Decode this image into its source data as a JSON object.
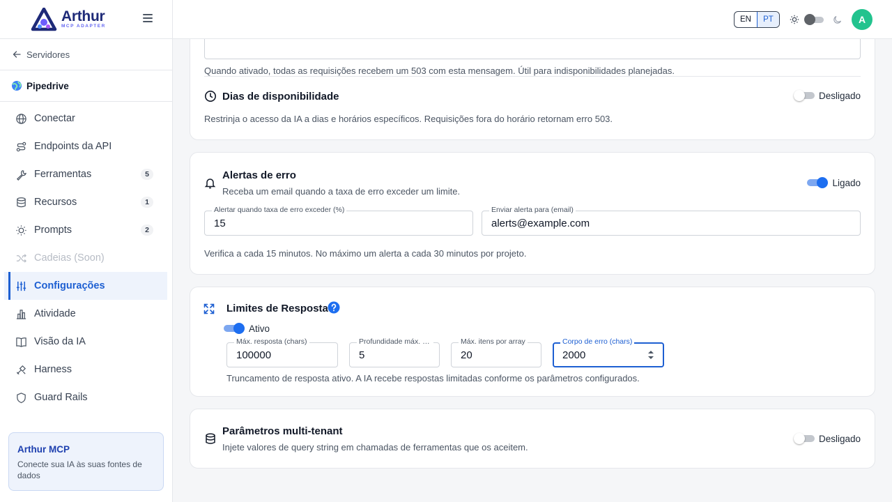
{
  "app": {
    "name": "Arthur",
    "subtitle": "MCP ADAPTER"
  },
  "sidebar": {
    "back_label": "Servidores",
    "server_name": "Pipedrive",
    "items": [
      {
        "label": "Conectar",
        "icon": "globe-icon"
      },
      {
        "label": "Endpoints da API",
        "icon": "route-icon"
      },
      {
        "label": "Ferramentas",
        "icon": "wrench-icon",
        "badge": "5"
      },
      {
        "label": "Recursos",
        "icon": "database-icon",
        "badge": "1"
      },
      {
        "label": "Prompts",
        "icon": "bulb-icon",
        "badge": "2"
      },
      {
        "label": "Cadeias (Soon)",
        "icon": "shuffle-icon"
      },
      {
        "label": "Configurações",
        "icon": "sliders-icon"
      },
      {
        "label": "Atividade",
        "icon": "chart-icon"
      },
      {
        "label": "Visão da IA",
        "icon": "book-icon"
      },
      {
        "label": "Harness",
        "icon": "tools-icon"
      },
      {
        "label": "Guard Rails",
        "icon": "shield-icon"
      }
    ],
    "promo": {
      "title": "Arthur MCP",
      "text": "Conecte sua IA às suas fontes de dados"
    }
  },
  "topbar": {
    "lang_en": "EN",
    "lang_pt": "PT",
    "avatar_initial": "A"
  },
  "maintenance": {
    "help": "Quando ativado, todas as requisições recebem um 503 com esta mensagem. Útil para indisponibilidades planejadas."
  },
  "availability": {
    "title": "Dias de disponibilidade",
    "status": "Desligado",
    "help": "Restrinja o acesso da IA a dias e horários específicos. Requisições fora do horário retornam erro 503."
  },
  "error_alerts": {
    "title": "Alertas de erro",
    "subtitle": "Receba um email quando a taxa de erro exceder um limite.",
    "status": "Ligado",
    "threshold_label": "Alertar quando taxa de erro exceder (%)",
    "threshold_value": "15",
    "email_label": "Enviar alerta para (email)",
    "email_value": "alerts@example.com",
    "help": "Verifica a cada 15 minutos. No máximo um alerta a cada 30 minutos por projeto."
  },
  "response_limits": {
    "title": "Limites de Resposta",
    "status": "Ativo",
    "fields": [
      {
        "label": "Máx. resposta (chars)",
        "value": "100000"
      },
      {
        "label": "Profundidade máx. de objeto",
        "value": "5"
      },
      {
        "label": "Máx. itens por array",
        "value": "20"
      },
      {
        "label": "Corpo de erro (chars)",
        "value": "2000"
      }
    ],
    "help": "Truncamento de resposta ativo. A IA recebe respostas limitadas conforme os parâmetros configurados."
  },
  "multi_tenant": {
    "title": "Parâmetros multi-tenant",
    "subtitle": "Injete valores de query string em chamadas de ferramentas que os aceitem.",
    "status": "Desligado"
  },
  "colors": {
    "accent": "#1d5fd2",
    "avatar": "#22c38e",
    "switch_on": "#1d6ef0"
  }
}
